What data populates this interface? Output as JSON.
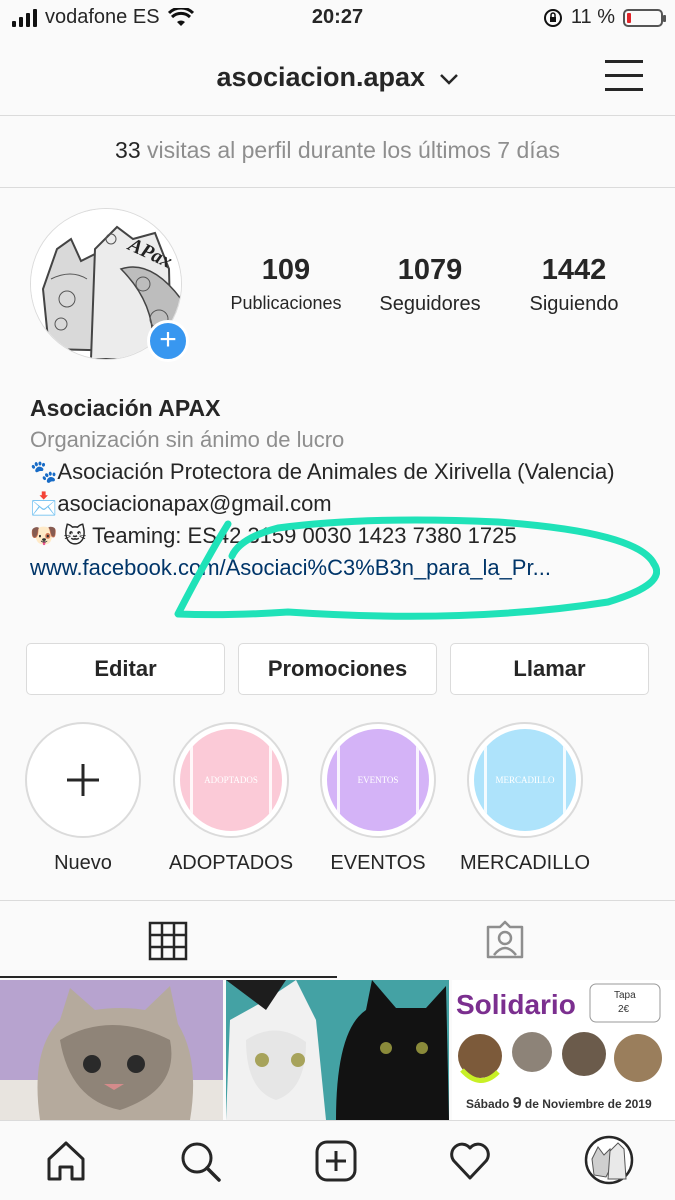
{
  "status_bar": {
    "carrier": "vodafone ES",
    "time": "20:27",
    "battery": "11 %"
  },
  "nav": {
    "username": "asociacion.apax"
  },
  "visits": {
    "count": "33",
    "text": " visitas al perfil durante los últimos 7 días"
  },
  "profile": {
    "avatar_text": "APax",
    "stats": [
      {
        "value": "109",
        "label": "Publicaciones"
      },
      {
        "value": "1079",
        "label": "Seguidores"
      },
      {
        "value": "1442",
        "label": "Siguiendo"
      }
    ]
  },
  "bio": {
    "name": "Asociación APAX",
    "category": "Organización sin ánimo de lucro",
    "line1": "🐾Asociación Protectora de Animales de Xirivella (Valencia)",
    "line2": "📩asociacionapax@gmail.com",
    "line3": "🐶 🐱 Teaming: ES42 3159 0030 1423 7380 1725",
    "link": "www.facebook.com/Asociaci%C3%B3n_para_la_Pr..."
  },
  "buttons": {
    "edit": "Editar",
    "promotions": "Promociones",
    "call": "Llamar"
  },
  "highlights": [
    {
      "label": "Nuevo",
      "inner": ""
    },
    {
      "label": "ADOPTADOS",
      "inner": "ADOPTADOS",
      "color": "#fbcad7"
    },
    {
      "label": "EVENTOS",
      "inner": "EVENTOS",
      "color": "#d4b3f7"
    },
    {
      "label": "MERCADILLO",
      "inner": "MERCADILLO",
      "color": "#aee3fb"
    }
  ],
  "posts": {
    "third": {
      "title": "Solidario",
      "tag": "Tapa",
      "price": "2€",
      "date_prefix": "Sábado ",
      "date_day": "9",
      "date_suffix": " de Noviembre de 2019"
    }
  },
  "colors": {
    "accent": "#3897f0",
    "annotation": "#1fe2b8",
    "link": "#003569"
  }
}
